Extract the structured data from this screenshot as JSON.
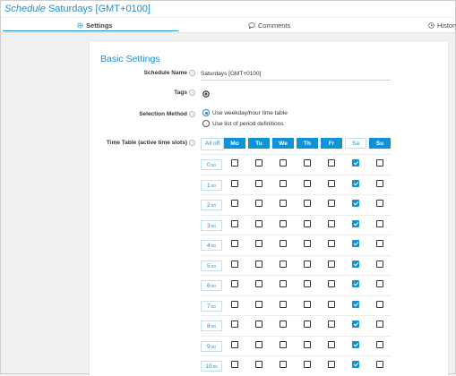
{
  "header": {
    "title_prefix": "Schedule",
    "title_name": "Saturdays [GMT+0100]"
  },
  "tabs": [
    {
      "label": "Settings",
      "icon": "gear-icon",
      "active": true
    },
    {
      "label": "Comments",
      "icon": "speech-bubble-icon",
      "active": false
    },
    {
      "label": "History",
      "icon": "clock-icon",
      "active": false
    }
  ],
  "section_title": "Basic Settings",
  "fields": {
    "schedule_name": {
      "label": "Schedule Name",
      "value": "Saturdays [GMT+0100]"
    },
    "tags": {
      "label": "Tags",
      "add_icon": "plus-circle-icon"
    },
    "selection_method": {
      "label": "Selection Method",
      "options": [
        "Use weekday/hour time table",
        "Use list of period definitions"
      ],
      "selected": 0
    },
    "time_table": {
      "label": "Time Table (active time slots)",
      "all_off": "All off",
      "days": [
        "Mo",
        "Tu",
        "We",
        "Th",
        "Fr",
        "Sa",
        "Su"
      ],
      "days_active": [
        true,
        true,
        true,
        true,
        true,
        false,
        true
      ],
      "minute_suffix": ":00",
      "hours": [
        {
          "hour": "0",
          "checked": [
            false,
            false,
            false,
            false,
            false,
            true,
            false
          ]
        },
        {
          "hour": "1",
          "checked": [
            false,
            false,
            false,
            false,
            false,
            true,
            false
          ]
        },
        {
          "hour": "2",
          "checked": [
            false,
            false,
            false,
            false,
            false,
            true,
            false
          ]
        },
        {
          "hour": "3",
          "checked": [
            false,
            false,
            false,
            false,
            false,
            true,
            false
          ]
        },
        {
          "hour": "4",
          "checked": [
            false,
            false,
            false,
            false,
            false,
            true,
            false
          ]
        },
        {
          "hour": "5",
          "checked": [
            false,
            false,
            false,
            false,
            false,
            true,
            false
          ]
        },
        {
          "hour": "6",
          "checked": [
            false,
            false,
            false,
            false,
            false,
            true,
            false
          ]
        },
        {
          "hour": "7",
          "checked": [
            false,
            false,
            false,
            false,
            false,
            true,
            false
          ]
        },
        {
          "hour": "8",
          "checked": [
            false,
            false,
            false,
            false,
            false,
            true,
            false
          ]
        },
        {
          "hour": "9",
          "checked": [
            false,
            false,
            false,
            false,
            false,
            true,
            false
          ]
        },
        {
          "hour": "10",
          "checked": [
            false,
            false,
            false,
            false,
            false,
            true,
            false
          ]
        }
      ]
    }
  },
  "colors": {
    "accent": "#1a8fd1",
    "header_blue": "#1192d6"
  }
}
